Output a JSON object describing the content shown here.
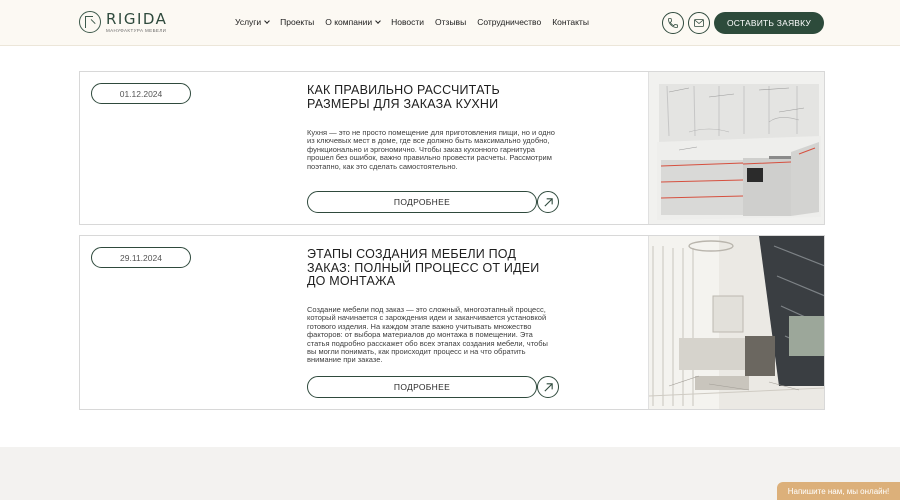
{
  "header": {
    "logo_title": "RIGIDA",
    "logo_subtitle": "МАНУФАКТУРА МЕБЕЛИ",
    "nav": [
      {
        "label": "Услуги"
      },
      {
        "label": "Проекты"
      },
      {
        "label": "О компании"
      },
      {
        "label": "Новости"
      },
      {
        "label": "Отзывы"
      },
      {
        "label": "Сотрудничество"
      },
      {
        "label": "Контакты"
      }
    ],
    "phone_icon": "phone-icon",
    "mail_icon": "mail-icon",
    "cta_label": "ОСТАВИТЬ ЗАЯВКУ"
  },
  "articles": [
    {
      "date": "01.12.2024",
      "title": "КАК ПРАВИЛЬНО РАССЧИТАТЬ РАЗМЕРЫ ДЛЯ ЗАКАЗА КУХНИ",
      "text": "Кухня — это не просто помещение для приготовления пищи, но и одно из ключевых мест в доме, где все должно быть максимально удобно, функционально и эргономично. Чтобы заказ кухонного гарнитура прошел без ошибок, важно правильно провести расчеты. Рассмотрим поэтапно, как это сделать самостоятельно.",
      "more_label": "ПОДРОБНЕЕ"
    },
    {
      "date": "29.11.2024",
      "title": "ЭТАПЫ СОЗДАНИЯ МЕБЕЛИ ПОД ЗАКАЗ: ПОЛНЫЙ ПРОЦЕСС ОТ ИДЕИ ДО МОНТАЖА",
      "text": "Создание мебели под заказ — это сложный, многоэтапный процесс, который начинается с зарождения идеи и заканчивается установкой готового изделия. На каждом этапе важно учитывать множество факторов: от выбора материалов до монтажа в помещении. Эта статья подробно расскажет обо всех этапах создания мебели, чтобы вы могли понимать, как происходит процесс и на что обратить внимание при заказе.",
      "more_label": "ПОДРОБНЕЕ"
    }
  ],
  "chat_label": "Напишите нам, мы онлайн!",
  "colors": {
    "brand": "#2d4b3b",
    "header_bg": "#fcf9f3",
    "chat": "#dcb07a"
  }
}
